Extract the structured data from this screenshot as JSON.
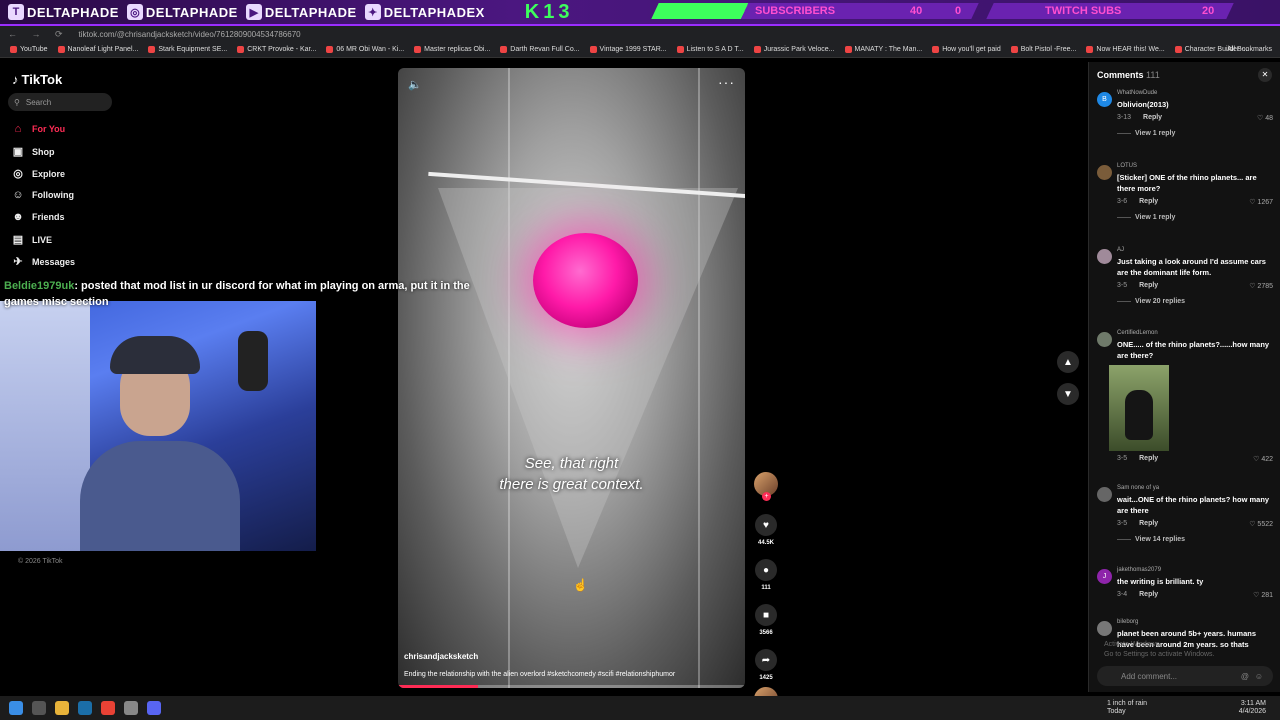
{
  "overlay": {
    "handles": [
      "DELTAPHADE",
      "DELTAPHADE",
      "DELTAPHADE",
      "DELTAPHADEX"
    ],
    "k13": "K13",
    "subscribers_label": "SUBSCRIBERS",
    "subscribers_count": "40",
    "subscribers_goal": "0",
    "twitch_subs_label": "TWITCH SUBS",
    "twitch_subs_count": "20"
  },
  "browser": {
    "url": "tiktok.com/@chrisandjacksketch/video/7612809004534786670",
    "bookmarks": [
      "YouTube",
      "Nanoleaf Light Panel...",
      "Stark Equipment SE...",
      "CRKT Provoke - Kar...",
      "06 MR Obi Wan - Ki...",
      "Master replicas Obi...",
      "Darth Revan Full Co...",
      "Vintage 1999 STAR...",
      "Listen to S A D T...",
      "Jurassic Park Veloce...",
      "MANATY : The Man...",
      "How you'll get paid",
      "Bolt Pistol -Free...",
      "Now HEAR this! We...",
      "Character Builder -..."
    ],
    "all_bookmarks": "All Bookmarks"
  },
  "sidebar": {
    "logo": "TikTok",
    "search_placeholder": "Search",
    "items": [
      {
        "label": "For You",
        "icon": "home-icon"
      },
      {
        "label": "Shop",
        "icon": "shop-icon"
      },
      {
        "label": "Explore",
        "icon": "compass-icon"
      },
      {
        "label": "Following",
        "icon": "following-icon"
      },
      {
        "label": "Friends",
        "icon": "friends-icon"
      },
      {
        "label": "LIVE",
        "icon": "live-icon"
      },
      {
        "label": "Messages",
        "icon": "messages-icon"
      }
    ],
    "footer": "© 2026 TikTok"
  },
  "chat": {
    "user": "Beldie1979uk",
    "message": ": posted that mod list in ur discord for what im playing on arma, put it in the games misc section"
  },
  "video": {
    "caption_line1": "See, that right",
    "caption_line2": "there is great context.",
    "username": "chrisandjacksketch",
    "description": "Ending the relationship with the alien overlord #sketchcomedy #scifi #relationshiphumor",
    "progress": 0.23
  },
  "actions": {
    "likes": "44.5K",
    "comments": "111",
    "saves": "3566",
    "shares": "1425"
  },
  "comments_panel": {
    "title": "Comments",
    "count": "111",
    "comments": [
      {
        "user": "WhatNowDude",
        "avatar_letter": "B",
        "text": "Oblivion(2013)",
        "date": "3-13",
        "likes": "48",
        "view": "View 1 reply"
      },
      {
        "user": "LOTUS",
        "avatar_letter": "",
        "text": "[Sticker] ONE of the rhino planets... are there more?",
        "date": "3-6",
        "likes": "1267",
        "view": "View 1 reply"
      },
      {
        "user": "AJ",
        "avatar_letter": "",
        "text": "Just taking a look around I'd assume cars are the dominant life form.",
        "date": "3-5",
        "likes": "2785",
        "view": "View 20 replies"
      },
      {
        "user": "CertifiedLemon",
        "avatar_letter": "",
        "text": "ONE..... of the rhino planets?......how many are there?",
        "date": "3-5",
        "likes": "422",
        "view": ""
      },
      {
        "user": "Sam none of ya",
        "avatar_letter": "",
        "text": "wait...ONE of the rhino planets? how many are there",
        "date": "3-5",
        "likes": "5522",
        "view": "View 14 replies"
      },
      {
        "user": "jakethomas2079",
        "avatar_letter": "J",
        "text": "the writing is brilliant. ty",
        "date": "3-4",
        "likes": "281",
        "view": ""
      },
      {
        "user": "bileborg",
        "avatar_letter": "",
        "text": "planet been around 5b+ years. humans have been around 2m years. so thats",
        "date": "",
        "likes": "",
        "view": ""
      }
    ],
    "reply_label": "Reply",
    "add_placeholder": "Add comment...",
    "watermark_line1": "Activate Windows",
    "watermark_line2": "Go to Settings to activate Windows."
  },
  "taskbar": {
    "weather_line1": "1 inch of rain",
    "weather_line2": "Today",
    "time": "3:11 AM",
    "date": "4/4/2026"
  },
  "colors": {
    "accent": "#fe2c55",
    "overlay_purple": "#4b1780",
    "overlay_green": "#3dff5c"
  }
}
